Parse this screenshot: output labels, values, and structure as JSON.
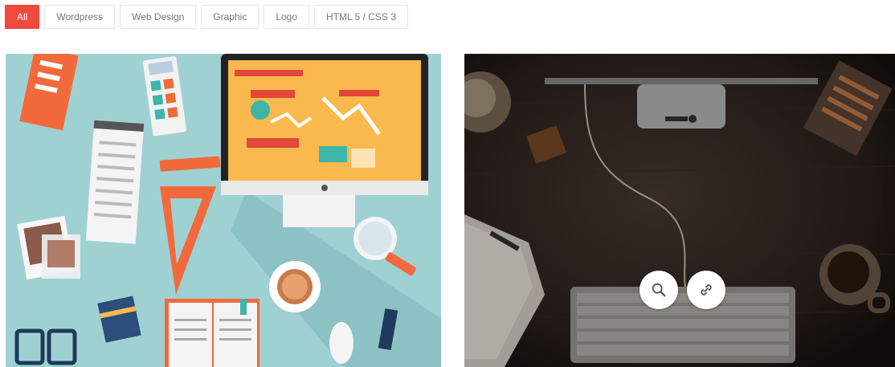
{
  "filters": [
    {
      "label": "All",
      "active": true
    },
    {
      "label": "Wordpress",
      "active": false
    },
    {
      "label": "Web Design",
      "active": false
    },
    {
      "label": "Graphic",
      "active": false
    },
    {
      "label": "Logo",
      "active": false
    },
    {
      "label": "HTML 5 / CSS 3",
      "active": false
    }
  ],
  "portfolio": {
    "items": [
      {
        "image_icon": "flat-design-workspace-illustration"
      },
      {
        "image_icon": "dark-desk-keyboard-photo",
        "overlay_icons": [
          "zoom-icon",
          "link-icon"
        ]
      }
    ]
  },
  "colors": {
    "accent": "#f04a3e",
    "filter_text": "#777777",
    "card_left_bg": "#9fd1d3",
    "card_right_bg": "#2a231f"
  }
}
